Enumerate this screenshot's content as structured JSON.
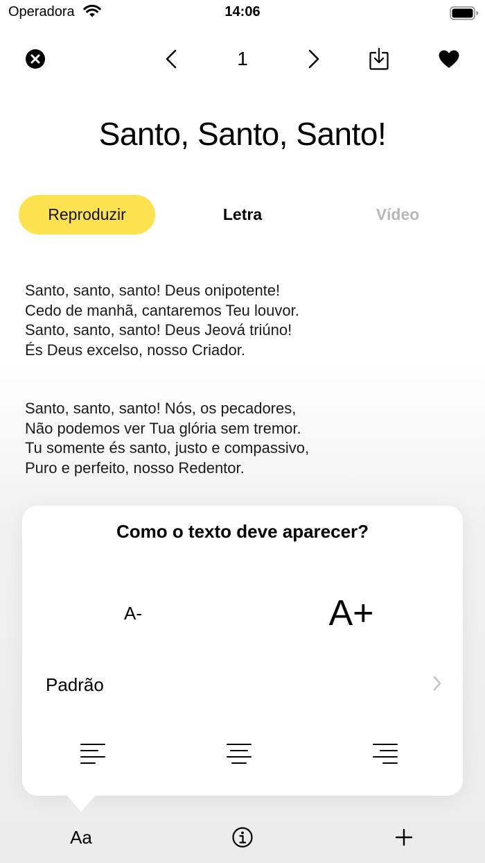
{
  "status_bar": {
    "carrier": "Operadora",
    "time": "14:06"
  },
  "top_bar": {
    "page_number": "1",
    "icons": [
      "close-icon",
      "chevron-left-icon",
      "chevron-right-icon",
      "download-icon",
      "heart-icon"
    ]
  },
  "song": {
    "title": "Santo, Santo, Santo!"
  },
  "tabs": [
    {
      "label": "Reproduzir",
      "selected": false
    },
    {
      "label": "Letra",
      "selected": true
    },
    {
      "label": "Vídeo",
      "selected": false
    }
  ],
  "lyrics": {
    "verses": [
      [
        "Santo, santo, santo! Deus onipotente!",
        "Cedo de manhã, cantaremos Teu louvor.",
        "Santo, santo, santo! Deus Jeová triúno!",
        "És Deus excelso, nosso Criador."
      ],
      [
        "Santo, santo, santo! Nós, os pecadores,",
        "Não podemos ver Tua glória sem tremor.",
        "Tu somente és santo, justo e compassivo,",
        "Puro e perfeito, nosso Redentor."
      ]
    ]
  },
  "text_popover": {
    "title": "Como o texto deve aparecer?",
    "decrease_label": "A-",
    "increase_label": "A+",
    "font_label": "Padrão",
    "alignment_icons": [
      "align-left-icon",
      "align-center-icon",
      "align-right-icon"
    ]
  },
  "bottom_toolbar": {
    "text_button_label": "Aa",
    "icons": [
      "info-icon",
      "plus-icon"
    ]
  },
  "colors": {
    "accent": "#fde24f",
    "disabled_tab": "#b8b8b8",
    "chevron": "#c4c4c4"
  }
}
